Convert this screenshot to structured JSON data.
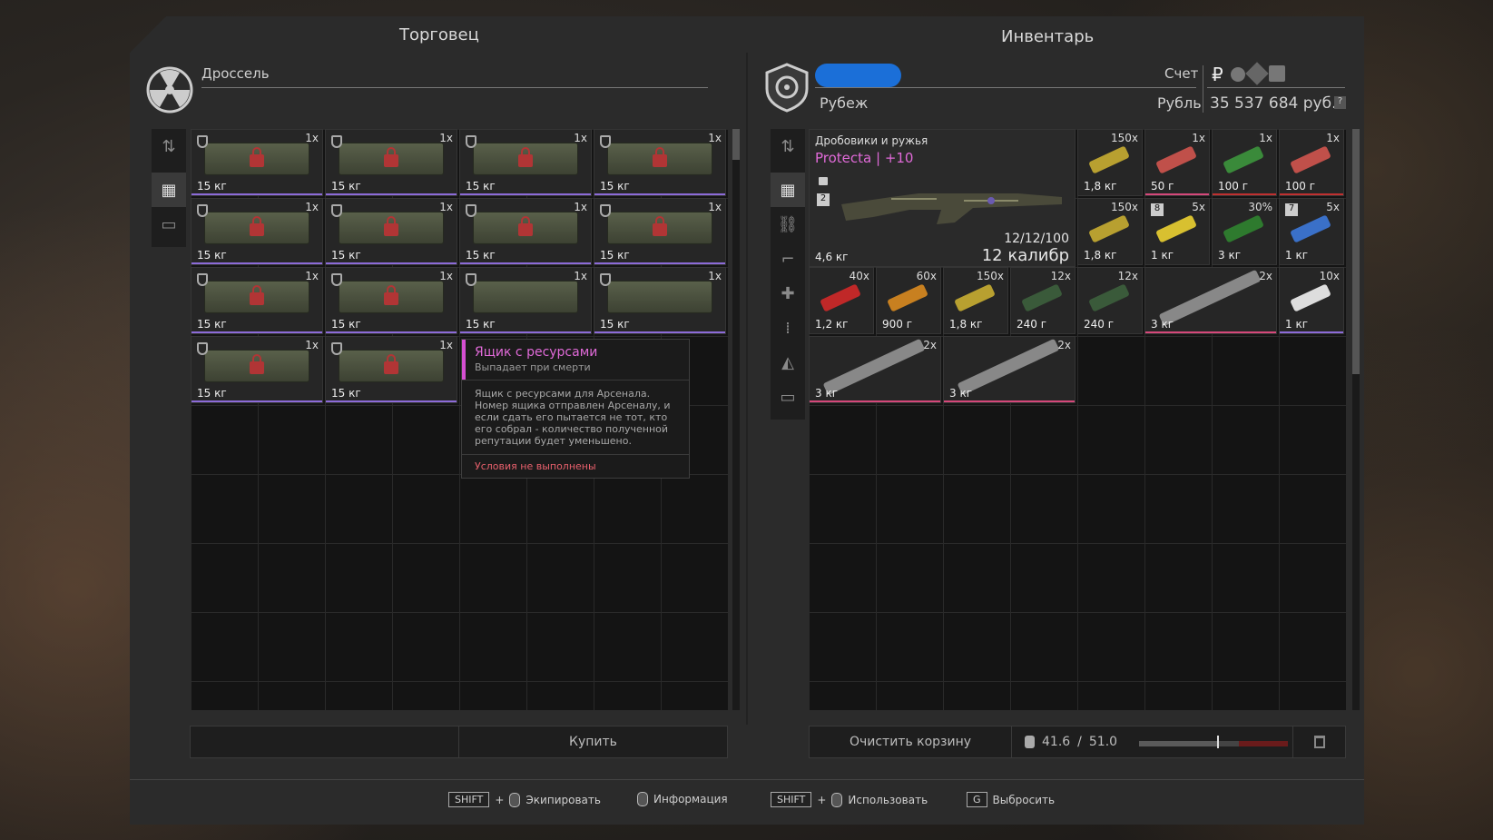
{
  "trader": {
    "panel_title": "Торговец",
    "name": "Дроссель",
    "buy_label": "Купить"
  },
  "inventory": {
    "panel_title": "Инвентарь",
    "faction": "Рубеж",
    "account_label": "Счет",
    "currency_label": "Рубль",
    "balance": "35 537 684 руб.",
    "currency_symbol": "₽",
    "help": "?",
    "clear_cart": "Очистить корзину",
    "weight_current": "41.6",
    "weight_sep": "/",
    "weight_max": "51.0"
  },
  "trader_items": [
    {
      "count": "1x",
      "weight": "15 кг",
      "locked": true
    },
    {
      "count": "1x",
      "weight": "15 кг",
      "locked": true
    },
    {
      "count": "1x",
      "weight": "15 кг",
      "locked": true
    },
    {
      "count": "1x",
      "weight": "15 кг",
      "locked": true
    },
    {
      "count": "1x",
      "weight": "15 кг",
      "locked": true
    },
    {
      "count": "1x",
      "weight": "15 кг",
      "locked": true
    },
    {
      "count": "1x",
      "weight": "15 кг",
      "locked": true
    },
    {
      "count": "1x",
      "weight": "15 кг",
      "locked": true
    },
    {
      "count": "1x",
      "weight": "15 кг",
      "locked": true
    },
    {
      "count": "1x",
      "weight": "15 кг",
      "locked": true
    },
    {
      "count": "1x",
      "weight": "15 кг",
      "locked": false
    },
    {
      "count": "1x",
      "weight": "15 кг",
      "locked": false
    },
    {
      "count": "1x",
      "weight": "15 кг",
      "locked": true
    },
    {
      "count": "1x",
      "weight": "15 кг",
      "locked": true
    }
  ],
  "tooltip": {
    "title": "Ящик с ресурсами",
    "subtitle": "Выпадает при смерти",
    "description": "Ящик с ресурсами для Арсенала. Номер ящика отправлен Арсеналу, и если сдать его пытается не тот, кто его собрал - количество полученной репутации будет уменьшено.",
    "warning": "Условия не выполнены"
  },
  "weapon": {
    "category": "Дробовики и ружья",
    "name": "Protecta | +10",
    "ammo": "12/12/100",
    "caliber": "12 калибр",
    "weight": "4,6 кг",
    "slot_badge": "2"
  },
  "inv_items": [
    {
      "count": "150x",
      "weight": "1,8 кг"
    },
    {
      "count": "1x",
      "weight": "50 г"
    },
    {
      "count": "1x",
      "weight": "100 г"
    },
    {
      "count": "1x",
      "weight": "100 г"
    },
    {
      "count": "150x",
      "weight": "1,8 кг"
    },
    {
      "count": "5x",
      "weight": "1 кг",
      "badge": "8"
    },
    {
      "count": "30%",
      "weight": "3 кг"
    },
    {
      "count": "5x",
      "weight": "1 кг",
      "badge": "7"
    },
    {
      "count": "40x",
      "weight": "1,2 кг"
    },
    {
      "count": "60x",
      "weight": "900 г"
    },
    {
      "count": "150x",
      "weight": "1,8 кг"
    },
    {
      "count": "12x",
      "weight": "240 г"
    },
    {
      "count": "12x",
      "weight": "240 г"
    },
    {
      "count": "2x",
      "weight": "3 кг"
    },
    {
      "count": "10x",
      "weight": "1 кг"
    },
    {
      "count": "2x",
      "weight": "3 кг"
    },
    {
      "count": "2x",
      "weight": "3 кг"
    }
  ],
  "hints": {
    "shift1": "SHIFT",
    "equip": "Экипировать",
    "info": "Информация",
    "shift2": "SHIFT",
    "use": "Использовать",
    "drop_key": "G",
    "drop": "Выбросить",
    "plus": "+"
  }
}
